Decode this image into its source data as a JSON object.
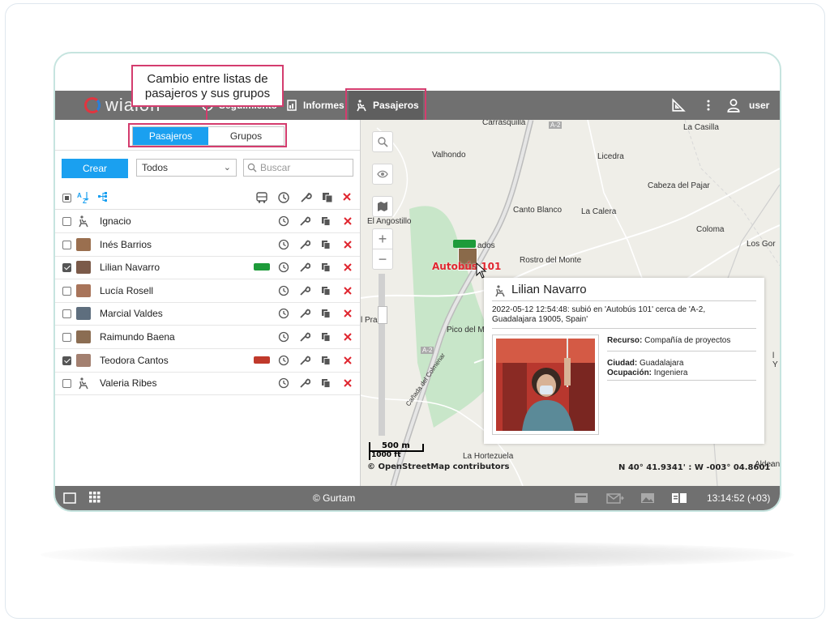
{
  "callout": {
    "line1": "Cambio entre listas de",
    "line2": "pasajeros y sus grupos"
  },
  "topbar": {
    "logo": "wialon",
    "nav": {
      "seguimiento": "Seguimiento",
      "informes": "Informes",
      "pasajeros": "Pasajeros"
    },
    "user": "user"
  },
  "tabs": {
    "pasajeros": "Pasajeros",
    "grupos": "Grupos"
  },
  "toolbar": {
    "create": "Crear",
    "filter_value": "Todos",
    "search_placeholder": "Buscar"
  },
  "passengers": [
    {
      "name": "Ignacio",
      "checked": false,
      "avatar": "seat-icon",
      "vehicle": ""
    },
    {
      "name": "Inés Barrios",
      "checked": false,
      "avatar": "photo",
      "vehicle": ""
    },
    {
      "name": "Lilian Navarro",
      "checked": true,
      "avatar": "photo",
      "vehicle": "green-bus-icon"
    },
    {
      "name": "Lucía Rosell",
      "checked": false,
      "avatar": "photo",
      "vehicle": ""
    },
    {
      "name": "Marcial Valdes",
      "checked": false,
      "avatar": "photo",
      "vehicle": ""
    },
    {
      "name": "Raimundo Baena",
      "checked": false,
      "avatar": "photo",
      "vehicle": ""
    },
    {
      "name": "Teodora Cantos",
      "checked": true,
      "avatar": "photo",
      "vehicle": "red-bus-icon"
    },
    {
      "name": "Valeria Ribes",
      "checked": false,
      "avatar": "seat-icon",
      "vehicle": ""
    }
  ],
  "map": {
    "labels": [
      "Carrasquilla",
      "La Casilla",
      "Valhondo",
      "Licedra",
      "Cabeza del Pajar",
      "El Angostillo",
      "Canto Blanco",
      "La Calera",
      "Coloma",
      "Los Gor",
      "Rostro del Monte",
      "Pico del M",
      "La Hortezuela",
      "Aldeanu",
      "A-2",
      "A-2",
      "Cañada del Colmenar",
      "l Pra",
      "l Y",
      "ados"
    ],
    "unit_label": "Autobús 101",
    "scale_m": "500 m",
    "scale_ft": "1000 ft",
    "attribution": "© OpenStreetMap contributors",
    "coordinates": "N 40° 41.9341' : W -003° 04.8601'"
  },
  "popup": {
    "name": "Lilian Navarro",
    "event_line1": "2022-05-12 12:54:48: subió en 'Autobús 101' cerca de 'A-2,",
    "event_line2": "Guadalajara 19005, Spain'",
    "resource_label": "Recurso:",
    "resource_value": "Compañía de proyectos",
    "city_label": "Ciudad:",
    "city_value": "Guadalajara",
    "occupation_label": "Ocupación:",
    "occupation_value": "Ingeniera"
  },
  "bottombar": {
    "brand": "© Gurtam",
    "time": "13:14:52 (+03)"
  },
  "colors": {
    "accent": "#1aa0f0",
    "highlight": "#d43c6e",
    "bar": "#707070",
    "delete": "#e0262f",
    "park": "#c8e6c9"
  }
}
